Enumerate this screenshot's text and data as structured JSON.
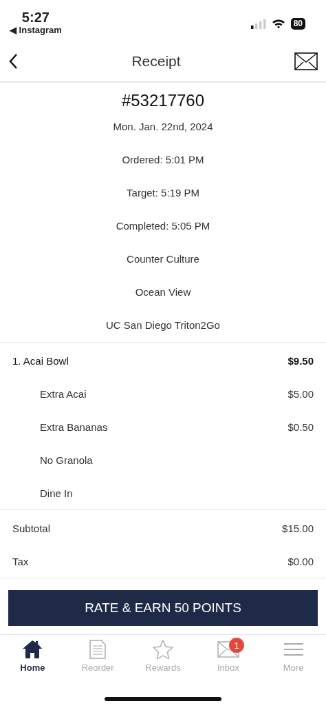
{
  "status_bar": {
    "time": "5:27",
    "back_app": "◀ Instagram",
    "battery": "80"
  },
  "header": {
    "title": "Receipt"
  },
  "receipt": {
    "order_number": "#53217760",
    "details": [
      "Mon. Jan. 22nd, 2024",
      "Ordered: 5:01 PM",
      "Target: 5:19 PM",
      "Completed: 5:05 PM",
      "Counter Culture",
      "Ocean View",
      "UC San Diego Triton2Go"
    ]
  },
  "lines": [
    {
      "kind": "item",
      "name": "1. Acai Bowl",
      "price": "$9.50"
    },
    {
      "kind": "modifier",
      "name": "Extra Acai",
      "price": "$5.00"
    },
    {
      "kind": "modifier",
      "name": "Extra Bananas",
      "price": "$0.50"
    },
    {
      "kind": "modifier",
      "name": "No Granola"
    },
    {
      "kind": "modifier",
      "name": "Dine In"
    }
  ],
  "totals": [
    {
      "label": "Subtotal",
      "value": "$15.00"
    },
    {
      "label": "Tax",
      "value": "$0.00"
    }
  ],
  "action_button": "RATE & EARN 50 POINTS",
  "tabs": [
    {
      "kind": "home",
      "label": "Home",
      "selected": true
    },
    {
      "kind": "reorder",
      "label": "Reorder",
      "selected": false
    },
    {
      "kind": "rewards",
      "label": "Rewards",
      "selected": false
    },
    {
      "kind": "inbox",
      "label": "Inbox",
      "selected": false,
      "badge": "1"
    },
    {
      "kind": "more",
      "label": "More",
      "selected": false
    }
  ]
}
